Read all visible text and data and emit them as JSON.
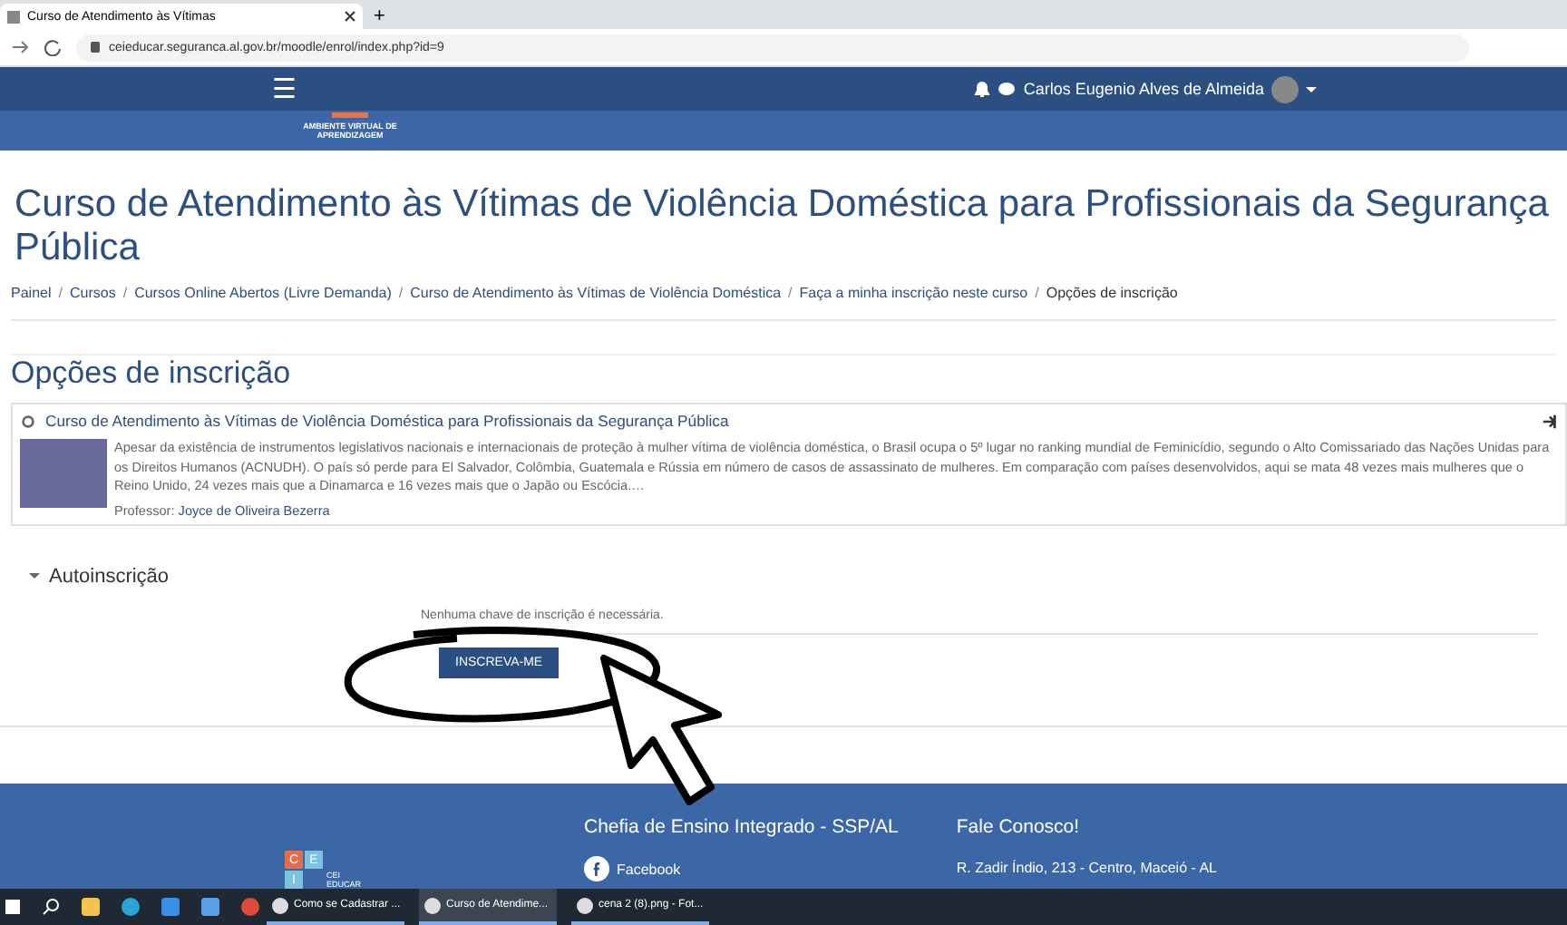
{
  "browser": {
    "tab_title": "Curso de Atendimento às Vítimas",
    "new_tab": "+",
    "url": "ceieducar.seguranca.al.gov.br/moodle/enrol/index.php?id=9"
  },
  "navbar": {
    "menu": "☰",
    "user_name": "Carlos Eugenio Alves de Almeida",
    "logo_text": "AMBIENTE VIRTUAL DE APRENDIZAGEM"
  },
  "page_title": "Curso de Atendimento às Vítimas de Violência Doméstica para Profissionais da Segurança Pública",
  "breadcrumb_separator": "/",
  "breadcrumb": [
    "Painel",
    "Cursos",
    "Cursos Online Abertos (Livre Demanda)",
    "Curso de Atendimento às Vítimas de Violência Doméstica",
    "Faça a minha inscrição neste curso",
    "Opções de inscrição"
  ],
  "section_title": "Opções de inscrição",
  "course": {
    "name": "Curso de Atendimento às Vítimas de Violência Doméstica para Profissionais da Segurança Pública",
    "summary": "Apesar da existência de instrumentos legislativos nacionais e internacionais de proteção à mulher vítima de violência doméstica, o Brasil ocupa o 5º lugar no ranking mundial de Feminicídio, segundo o Alto Comissariado das Nações Unidas para os Direitos Humanos (ACNUDH). O país só perde para El Salvador, Colômbia, Guatemala e Rússia em número de casos de assassinato de mulheres. Em comparação com países desenvolvidos, aqui se mata 48 vezes mais mulheres que o Reino Unido, 24 vezes mais que a Dinamarca e 16 vezes mais que o Japão ou Escócia.…",
    "teacher_label": "Professor:",
    "teacher": "Joyce de Oliveira Bezerra"
  },
  "enrol": {
    "title": "Autoinscrição",
    "expanded": true,
    "note": "Nenhuma chave de inscrição é necessária.",
    "button": "INSCREVA-ME"
  },
  "footer": {
    "logo_letters": [
      "C",
      "E",
      "I"
    ],
    "logo_text": "CEI EDUCAR",
    "org": "Chefia de Ensino Integrado - SSP/AL",
    "facebook": "Facebook",
    "contact_title": "Fale Conosco!",
    "address": "R. Zadir Índio, 213 - Centro, Maceió - AL"
  },
  "taskbar": [
    {
      "label": "Como se Cadastrar ...",
      "selected": false
    },
    {
      "label": "Curso de Atendime...",
      "selected": true
    },
    {
      "label": "cena 2 (8).png - Fot...",
      "selected": false
    }
  ]
}
